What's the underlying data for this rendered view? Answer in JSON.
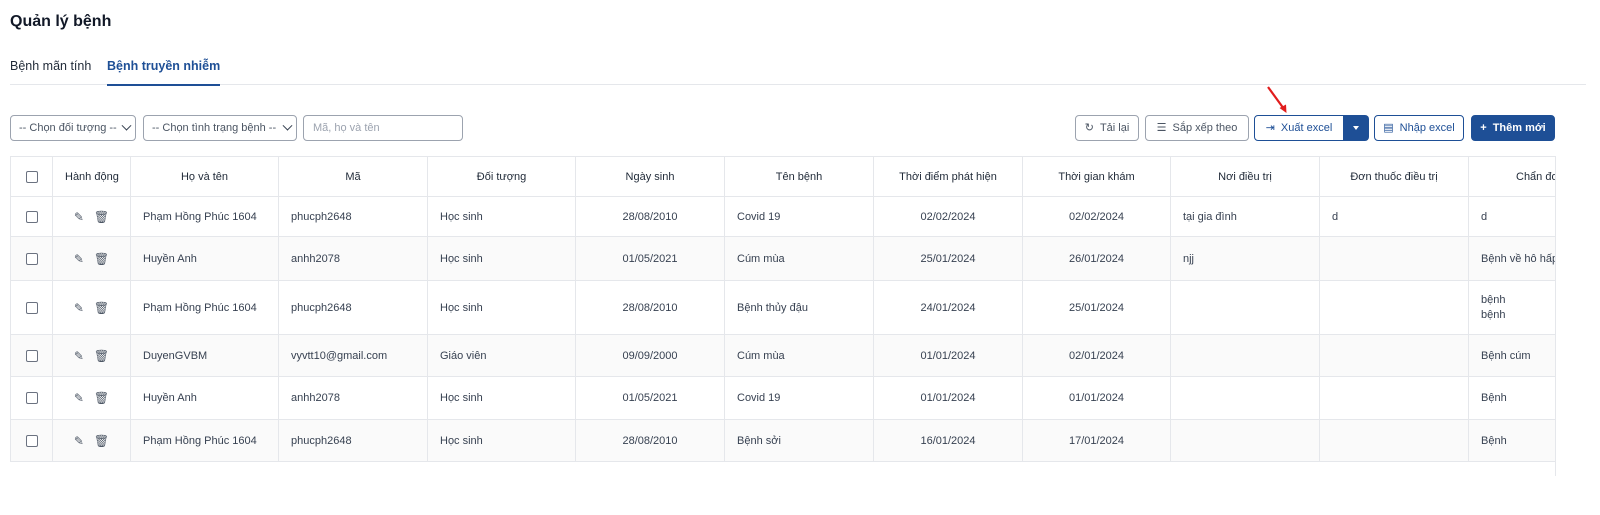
{
  "page": {
    "title": "Quản lý bệnh"
  },
  "tabs": [
    {
      "label": "Bệnh mãn tính",
      "active": false
    },
    {
      "label": "Bệnh truyền nhiễm",
      "active": true
    }
  ],
  "filters": {
    "object_select": "-- Chọn đối tượng --",
    "status_select": "-- Chọn tình trạng bệnh --",
    "search_placeholder": "Mã, họ và tên"
  },
  "toolbar": {
    "reload_label": "Tải lại",
    "sort_label": "Sắp xếp theo",
    "export_label": "Xuất excel",
    "import_label": "Nhập excel",
    "add_label": "Thêm mới"
  },
  "colors": {
    "primary": "#1e4f96",
    "annotation_arrow": "#e11d1d"
  },
  "icons": {
    "reload": "refresh-icon",
    "sort": "sort-icon",
    "export": "export-icon",
    "import": "file-icon",
    "add": "plus-icon",
    "edit": "pencil-icon",
    "delete": "trash-icon"
  },
  "table": {
    "headers": [
      "Hành động",
      "Họ và tên",
      "Mã",
      "Đối tượng",
      "Ngày sinh",
      "Tên bệnh",
      "Thời điểm phát hiện",
      "Thời gian khám",
      "Nơi điều trị",
      "Đơn thuốc điều trị",
      "Chẩn đoán"
    ],
    "rows": [
      {
        "name": "Phạm Hồng Phúc 1604",
        "code": "phucph2648",
        "object": "Học sinh",
        "dob": "28/08/2010",
        "disease": "Covid 19",
        "detected": "02/02/2024",
        "exam": "02/02/2024",
        "place": "tại gia đình",
        "prescription": "d",
        "diagnosis": "d"
      },
      {
        "name": "Huyền Anh",
        "code": "anhh2078",
        "object": "Học sinh",
        "dob": "01/05/2021",
        "disease": "Cúm mùa",
        "detected": "25/01/2024",
        "exam": "26/01/2024",
        "place": "njj",
        "prescription": "",
        "diagnosis": "Bệnh về hô hấp"
      },
      {
        "name": "Phạm Hồng Phúc 1604",
        "code": "phucph2648",
        "object": "Học sinh",
        "dob": "28/08/2010",
        "disease": "Bệnh thủy đậu",
        "detected": "24/01/2024",
        "exam": "25/01/2024",
        "place": "",
        "prescription": "",
        "diagnosis": "bệnh",
        "diagnosis2": "bệnh"
      },
      {
        "name": "DuyenGVBM",
        "code": "vyvtt10@gmail.com",
        "object": "Giáo viên",
        "dob": "09/09/2000",
        "disease": "Cúm mùa",
        "detected": "01/01/2024",
        "exam": "02/01/2024",
        "place": "",
        "prescription": "",
        "diagnosis": "Bệnh cúm"
      },
      {
        "name": "Huyền Anh",
        "code": "anhh2078",
        "object": "Học sinh",
        "dob": "01/05/2021",
        "disease": "Covid 19",
        "detected": "01/01/2024",
        "exam": "01/01/2024",
        "place": "",
        "prescription": "",
        "diagnosis": "Bệnh"
      },
      {
        "name": "Phạm Hồng Phúc 1604",
        "code": "phucph2648",
        "object": "Học sinh",
        "dob": "28/08/2010",
        "disease": "Bệnh sởi",
        "detected": "16/01/2024",
        "exam": "17/01/2024",
        "place": "",
        "prescription": "",
        "diagnosis": "Bệnh"
      }
    ]
  }
}
